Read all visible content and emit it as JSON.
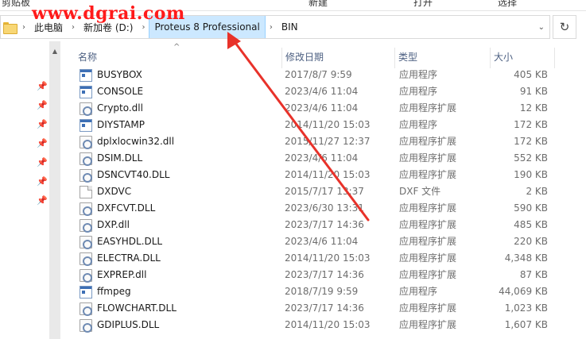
{
  "watermark": "www.dgrai.com",
  "ribbon": {
    "items": [
      "剪贴板",
      "新建",
      "打开",
      "选择"
    ]
  },
  "address": {
    "crumbs": [
      "此电脑",
      "新加卷 (D:)",
      "Proteus 8 Professional",
      "BIN"
    ],
    "highlighted": "Proteus 8 Professional"
  },
  "columns": {
    "name": "名称",
    "date": "修改日期",
    "type": "类型",
    "size": "大小"
  },
  "files": [
    {
      "name": "BUSYBOX",
      "date": "2017/8/7 9:59",
      "type": "应用程序",
      "size": "405 KB",
      "icon": "exe-icon"
    },
    {
      "name": "CONSOLE",
      "date": "2023/4/6 11:04",
      "type": "应用程序",
      "size": "91 KB",
      "icon": "exe-icon"
    },
    {
      "name": "Crypto.dll",
      "date": "2023/4/6 11:04",
      "type": "应用程序扩展",
      "size": "12 KB",
      "icon": "dll-icon"
    },
    {
      "name": "DIYSTAMP",
      "date": "2014/11/20 15:03",
      "type": "应用程序",
      "size": "172 KB",
      "icon": "exe-icon"
    },
    {
      "name": "dplxlocwin32.dll",
      "date": "2015/11/27 12:37",
      "type": "应用程序扩展",
      "size": "172 KB",
      "icon": "dll-icon"
    },
    {
      "name": "DSIM.DLL",
      "date": "2023/4/6 11:04",
      "type": "应用程序扩展",
      "size": "552 KB",
      "icon": "dll-icon"
    },
    {
      "name": "DSNCVT40.DLL",
      "date": "2014/11/20 15:03",
      "type": "应用程序扩展",
      "size": "190 KB",
      "icon": "dll-icon"
    },
    {
      "name": "DXDVC",
      "date": "2015/7/17 13:37",
      "type": "DXF 文件",
      "size": "2 KB",
      "icon": "file-icon"
    },
    {
      "name": "DXFCVT.DLL",
      "date": "2023/6/30 13:31",
      "type": "应用程序扩展",
      "size": "590 KB",
      "icon": "dll-icon"
    },
    {
      "name": "DXP.dll",
      "date": "2023/7/17 14:36",
      "type": "应用程序扩展",
      "size": "485 KB",
      "icon": "dll-icon"
    },
    {
      "name": "EASYHDL.DLL",
      "date": "2023/4/6 11:04",
      "type": "应用程序扩展",
      "size": "220 KB",
      "icon": "dll-icon"
    },
    {
      "name": "ELECTRA.DLL",
      "date": "2014/11/20 15:03",
      "type": "应用程序扩展",
      "size": "4,348 KB",
      "icon": "dll-icon"
    },
    {
      "name": "EXPREP.dll",
      "date": "2023/7/17 14:36",
      "type": "应用程序扩展",
      "size": "87 KB",
      "icon": "dll-icon"
    },
    {
      "name": "ffmpeg",
      "date": "2018/7/19 9:59",
      "type": "应用程序",
      "size": "44,069 KB",
      "icon": "exe-icon"
    },
    {
      "name": "FLOWCHART.DLL",
      "date": "2023/7/17 14:36",
      "type": "应用程序扩展",
      "size": "1,023 KB",
      "icon": "dll-icon"
    },
    {
      "name": "GDIPLUS.DLL",
      "date": "2014/11/20 15:03",
      "type": "应用程序扩展",
      "size": "1,607 KB",
      "icon": "dll-icon"
    }
  ],
  "colors": {
    "header_text": "#4d6082",
    "highlight": "#cce8ff",
    "arrow": "#e8322a",
    "watermark": "#ff1a1a"
  }
}
